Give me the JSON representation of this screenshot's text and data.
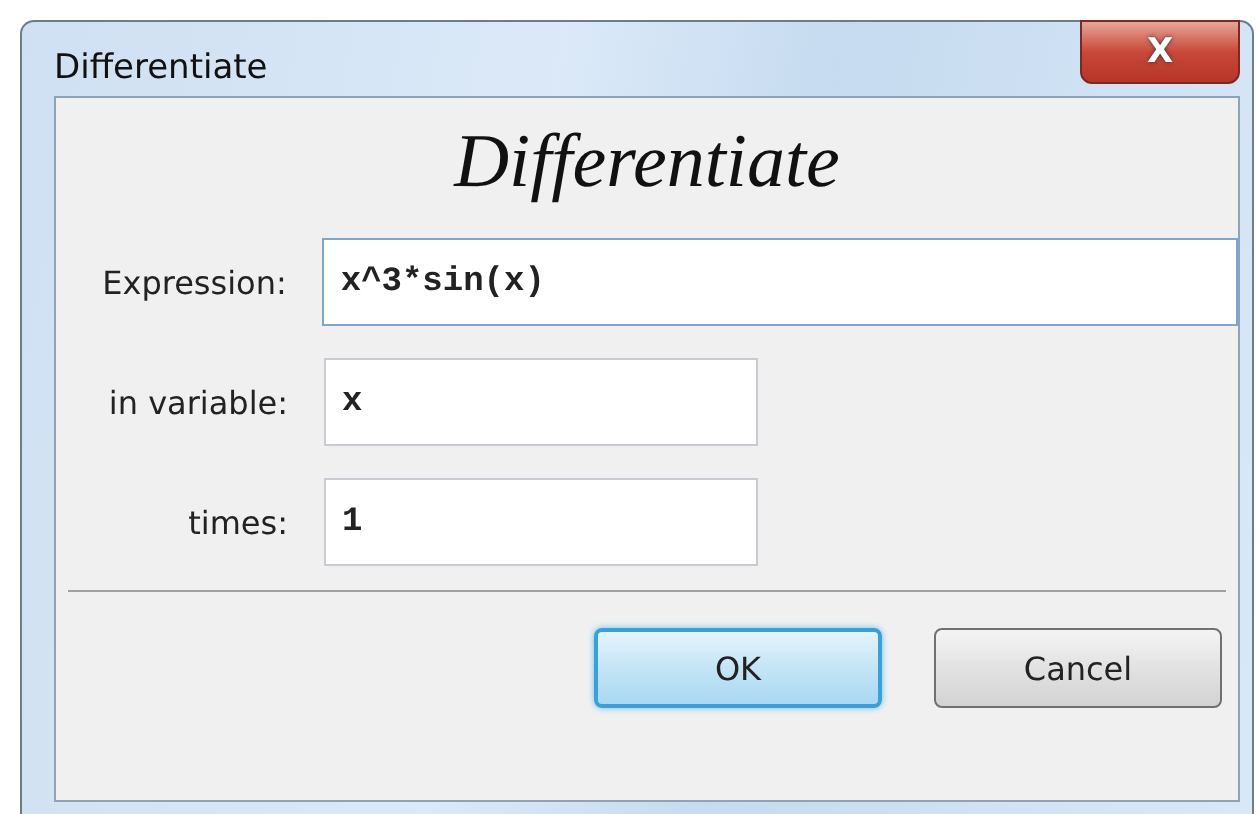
{
  "window": {
    "title": "Differentiate",
    "close_button": "X"
  },
  "heading": "Differentiate",
  "fields": [
    {
      "label": "Expression:",
      "value": "x^3*sin(x)",
      "wide": true
    },
    {
      "label": "in variable:",
      "value": "x",
      "wide": false
    },
    {
      "label": "times:",
      "value": "1",
      "wide": false
    }
  ],
  "buttons": [
    {
      "label": "OK",
      "default": true
    },
    {
      "label": "Cancel",
      "default": false
    }
  ]
}
